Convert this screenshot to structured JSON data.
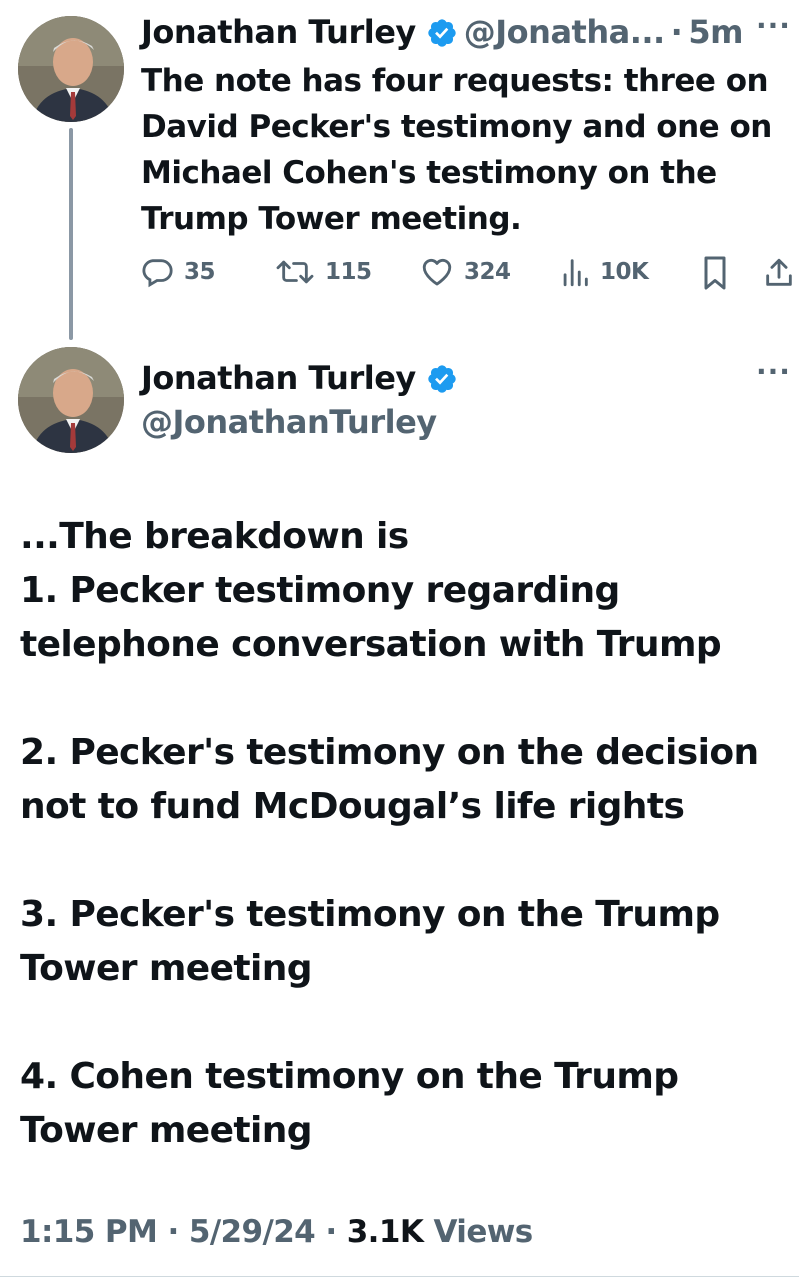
{
  "tweet_parent": {
    "author_name": "Jonathan Turley",
    "handle": "@Jonatha...",
    "separator": "·",
    "time": "5m",
    "more": "···",
    "text": "The note has four requests: three on\nDavid Pecker's testimony and one on\nMichael Cohen's testimony on the\nTrump Tower meeting.",
    "stats": {
      "replies": "35",
      "retweets": "115",
      "likes": "324",
      "views": "10K"
    }
  },
  "tweet_main": {
    "author_name": "Jonathan Turley",
    "handle": "@JonathanTurley",
    "more": "···",
    "text": "...The breakdown is\n1. Pecker testimony regarding\ntelephone conversation with Trump\n\n2. Pecker's testimony on the decision\nnot to fund McDougal’s life rights\n\n3. Pecker's testimony on the Trump\nTower meeting\n\n4. Cohen testimony on the Trump\nTower meeting",
    "meta": {
      "time": "1:15 PM",
      "sep1": " · ",
      "date": "5/29/24",
      "sep2": " · ",
      "views_count": "3.1K",
      "views_label": " Views"
    }
  },
  "icons": {
    "reply": "reply-bubble-icon",
    "retweet": "retweet-icon",
    "like": "heart-icon",
    "views": "analytics-bars-icon",
    "bookmark": "bookmark-icon",
    "share": "share-upload-icon",
    "verified": "verified-badge-icon"
  },
  "colors": {
    "text_primary": "#0f1419",
    "text_secondary": "#536471",
    "verified_blue": "#1d9bf0",
    "thread_line": "#8b98a5"
  }
}
